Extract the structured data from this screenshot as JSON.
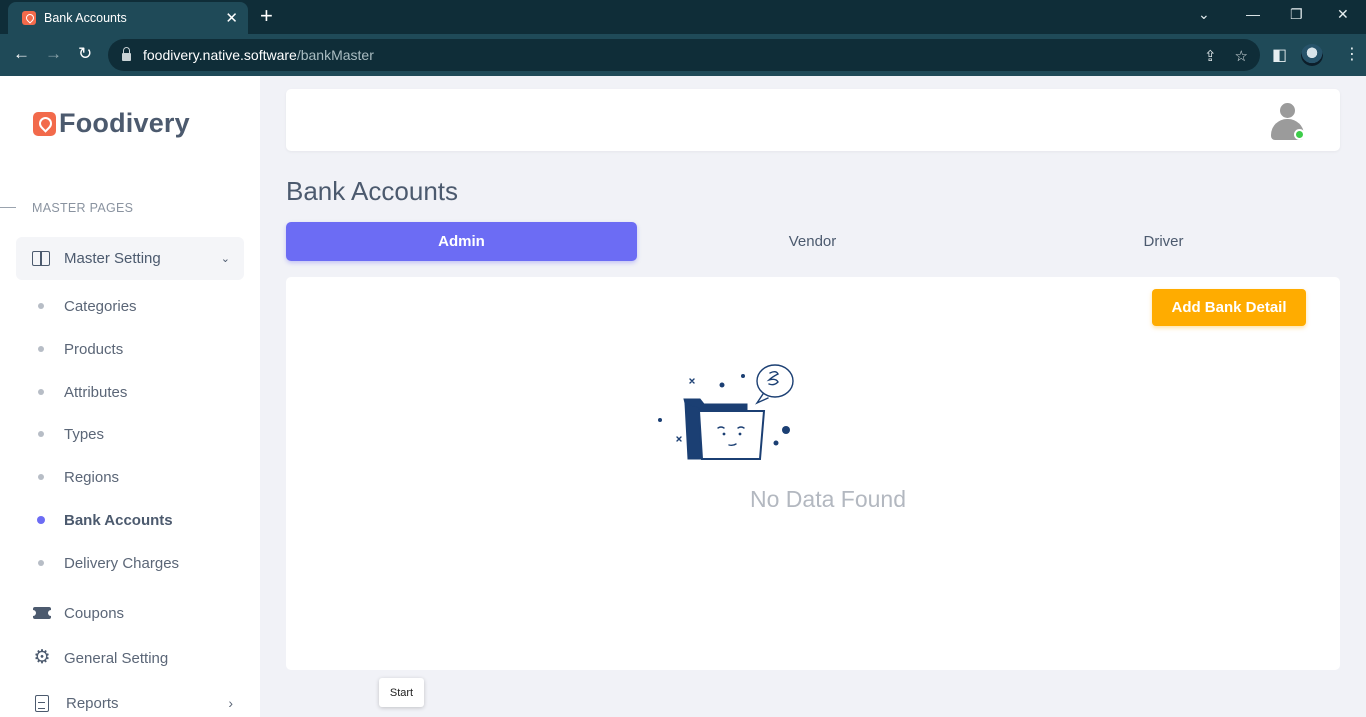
{
  "browser": {
    "tab_title": "Bank Accounts",
    "tab_close": "✕",
    "new_tab": "+",
    "url_host": "foodivery.native.software",
    "url_path": "/bankMaster",
    "icons": [
      "back-icon",
      "forward-icon",
      "reload-icon",
      "lock-icon",
      "share-icon",
      "star-icon",
      "sidepanel-icon",
      "profile-icon"
    ],
    "window_controls": {
      "minimize": "—",
      "restore": "❐",
      "close": "✕",
      "tab_search": "⌄"
    }
  },
  "sidebar": {
    "brand": "Foodivery",
    "section_label": "MASTER PAGES",
    "master_menu": {
      "label": "Master Setting",
      "chevron": "⌄",
      "icon": "book-icon"
    },
    "sub_items": [
      {
        "label": "Categories",
        "active": false
      },
      {
        "label": "Products",
        "active": false
      },
      {
        "label": "Attributes",
        "active": false
      },
      {
        "label": "Types",
        "active": false
      },
      {
        "label": "Regions",
        "active": false
      },
      {
        "label": "Bank Accounts",
        "active": true
      },
      {
        "label": "Delivery Charges",
        "active": false
      }
    ],
    "menu_items": [
      {
        "label": "Coupons",
        "icon": "coupon-icon"
      },
      {
        "label": "General Setting",
        "icon": "gear-icon"
      },
      {
        "label": "Reports",
        "icon": "report-icon",
        "chevron": "›"
      }
    ]
  },
  "main": {
    "page_title": "Bank Accounts",
    "tabs": [
      {
        "label": "Admin",
        "active": true
      },
      {
        "label": "Vendor",
        "active": false
      },
      {
        "label": "Driver",
        "active": false
      }
    ],
    "add_button": "Add Bank Detail",
    "empty_text": "No Data Found",
    "tooltip": "Start"
  },
  "colors": {
    "accent": "#6c6cf4",
    "button": "#ffac00",
    "brand": "#f26a4b",
    "online": "#3dcc4a",
    "illustration": "#1b3f73"
  }
}
